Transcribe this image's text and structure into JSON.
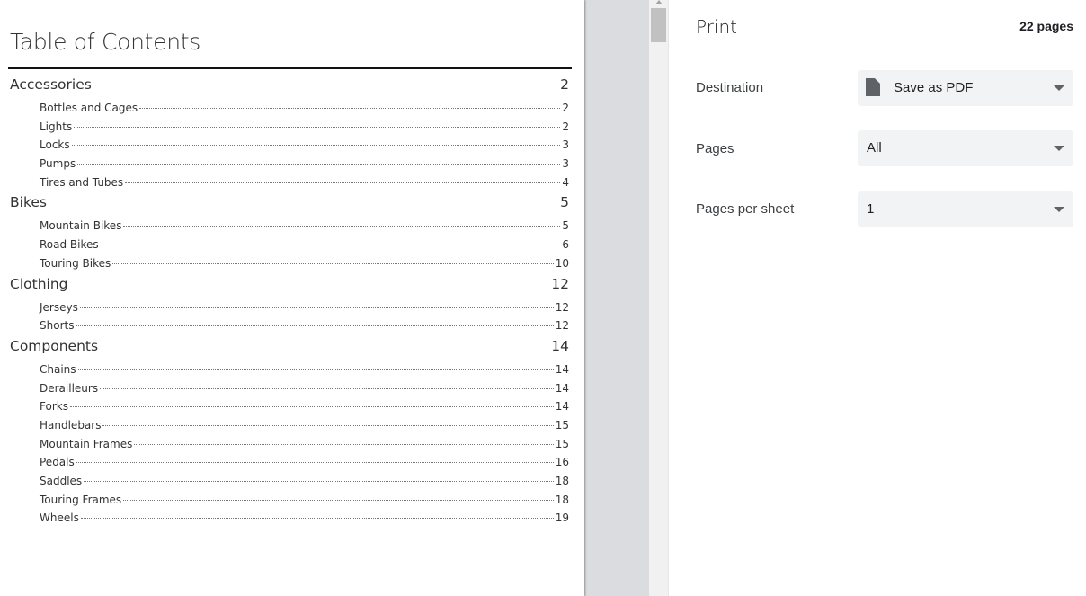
{
  "toc": {
    "title": "Table of Contents",
    "sections": [
      {
        "name": "Accessories",
        "page": "2",
        "entries": [
          {
            "name": "Bottles and Cages",
            "page": "2"
          },
          {
            "name": "Lights",
            "page": "2"
          },
          {
            "name": "Locks",
            "page": "3"
          },
          {
            "name": "Pumps",
            "page": "3"
          },
          {
            "name": "Tires and Tubes",
            "page": "4"
          }
        ]
      },
      {
        "name": "Bikes",
        "page": "5",
        "entries": [
          {
            "name": "Mountain Bikes",
            "page": "5"
          },
          {
            "name": "Road Bikes",
            "page": "6"
          },
          {
            "name": "Touring Bikes",
            "page": "10"
          }
        ]
      },
      {
        "name": "Clothing",
        "page": "12",
        "entries": [
          {
            "name": "Jerseys",
            "page": "12"
          },
          {
            "name": "Shorts",
            "page": "12"
          }
        ]
      },
      {
        "name": "Components",
        "page": "14",
        "entries": [
          {
            "name": "Chains",
            "page": "14"
          },
          {
            "name": "Derailleurs",
            "page": "14"
          },
          {
            "name": "Forks",
            "page": "14"
          },
          {
            "name": "Handlebars",
            "page": "15"
          },
          {
            "name": "Mountain Frames",
            "page": "15"
          },
          {
            "name": "Pedals",
            "page": "16"
          },
          {
            "name": "Saddles",
            "page": "18"
          },
          {
            "name": "Touring Frames",
            "page": "18"
          },
          {
            "name": "Wheels",
            "page": "19"
          }
        ]
      }
    ]
  },
  "print": {
    "title": "Print",
    "page_count": "22 pages",
    "destination": {
      "label": "Destination",
      "value": "Save as PDF",
      "icon": "file-icon"
    },
    "pages": {
      "label": "Pages",
      "value": "All"
    },
    "pages_per_sheet": {
      "label": "Pages per sheet",
      "value": "1"
    }
  },
  "colors": {
    "panel_background": "#ffffff",
    "preview_background": "#dadce0",
    "select_background": "#f1f3f4"
  }
}
